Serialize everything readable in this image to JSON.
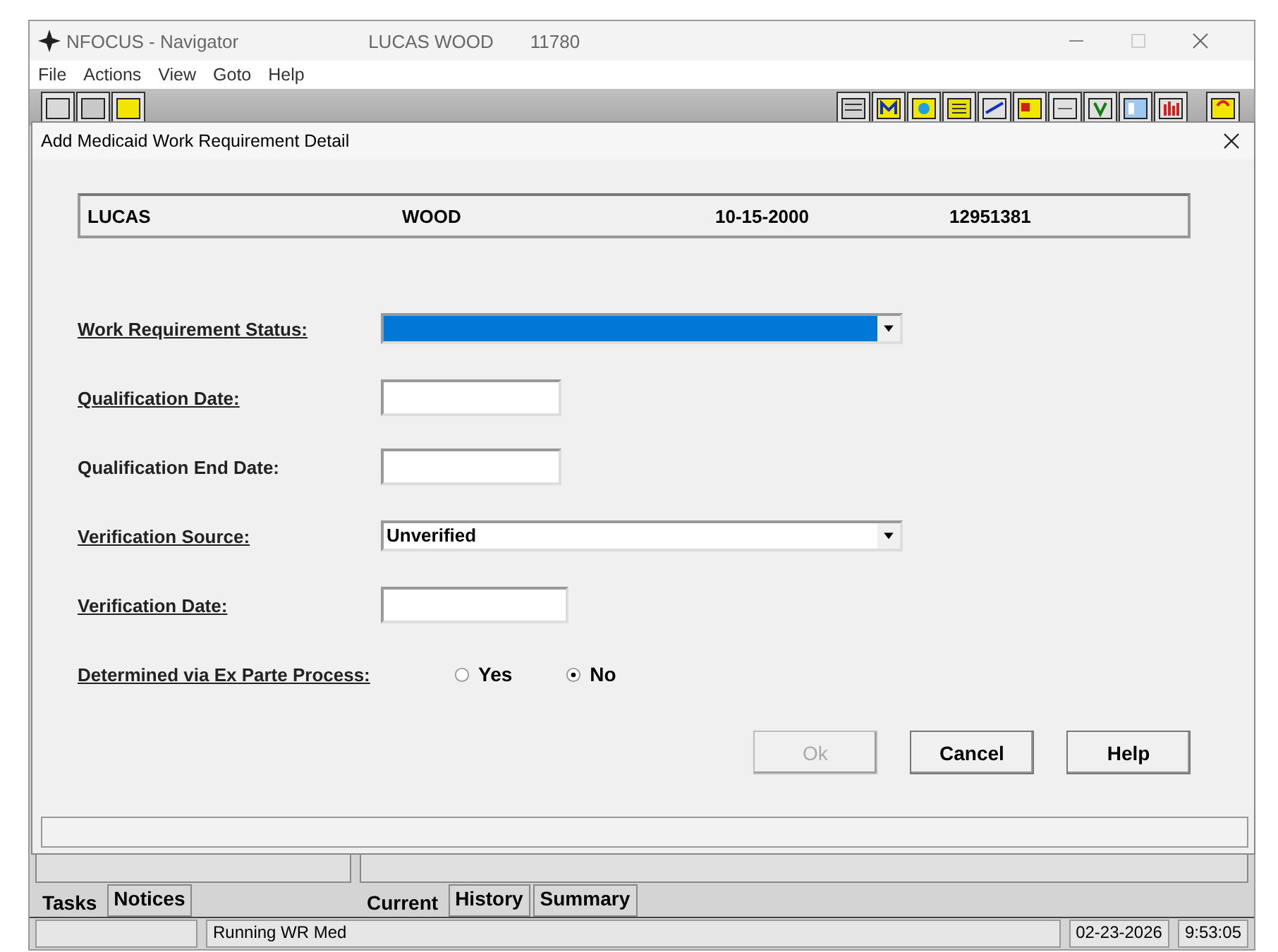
{
  "window": {
    "title": "NFOCUS - Navigator",
    "user": "LUCAS WOOD",
    "number": "11780"
  },
  "menu": [
    "File",
    "Actions",
    "View",
    "Goto",
    "Help"
  ],
  "dialog": {
    "title": "Add Medicaid Work Requirement Detail",
    "header": [
      "LUCAS",
      "WOOD",
      "10-15-2000",
      "12951381"
    ],
    "fields": [
      {
        "kind": "dropdown",
        "label": "Work Requirement Status:",
        "underlined": true,
        "highlighted": true
      },
      {
        "kind": "date",
        "label": "Qualification Date:",
        "underlined": true
      },
      {
        "kind": "date",
        "label": "Qualification End Date:",
        "underlined": false
      },
      {
        "kind": "dropdown",
        "label": "Verification Source:",
        "underlined": true,
        "highlighted": false,
        "value": "Unverified"
      },
      {
        "kind": "date",
        "label": "Verification Date:",
        "underlined": true
      },
      {
        "kind": "radio",
        "label": "Determined via Ex Parte Process:",
        "underlined": true,
        "options": [
          {
            "label": "Yes",
            "selected": false
          },
          {
            "label": "No",
            "selected": true
          }
        ]
      }
    ],
    "buttons": [
      {
        "label": "Ok",
        "disabled": true
      },
      {
        "label": "Cancel",
        "disabled": false
      },
      {
        "label": "Help",
        "disabled": false
      }
    ]
  },
  "side_tabs": [
    {
      "label": "Tasks",
      "selected": true
    },
    {
      "label": "Notices",
      "selected": false
    }
  ],
  "tabs": [
    {
      "label": "Current",
      "selected": true
    },
    {
      "label": "History",
      "selected": false
    },
    {
      "label": "Summary",
      "selected": false
    }
  ],
  "status_bar": {
    "message": "Running WR Med",
    "date": "02-23-2026",
    "time": "9:53:05"
  }
}
